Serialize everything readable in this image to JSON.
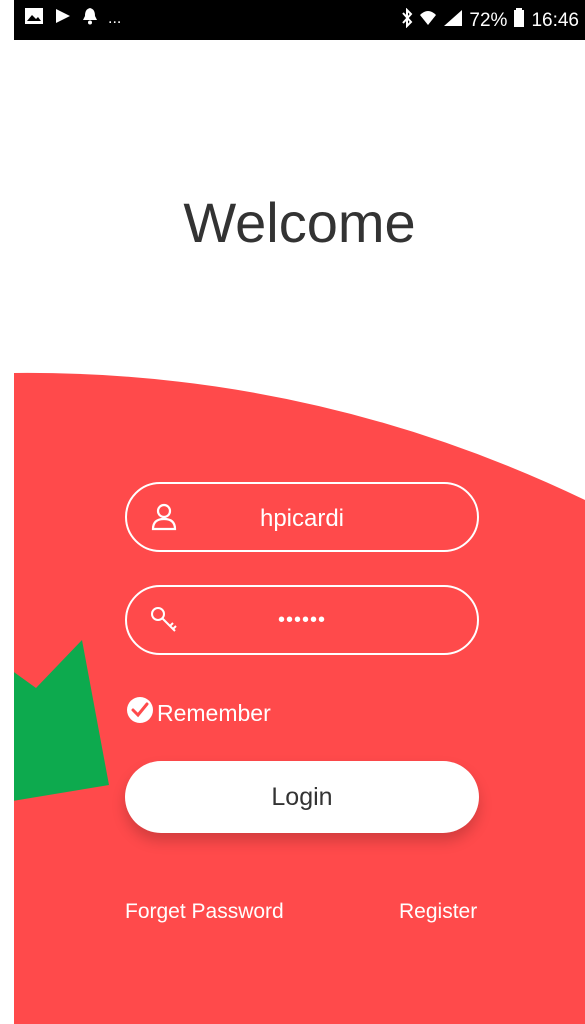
{
  "status_bar": {
    "battery": "72%",
    "time": "16:46",
    "dots": "..."
  },
  "title": "Welcome",
  "username": {
    "value": "hpicardi"
  },
  "password": {
    "masked_value": "••••••"
  },
  "remember": {
    "label": "Remember",
    "checked": true
  },
  "login_button": {
    "label": "Login"
  },
  "forgot_link": {
    "label": "Forget Password"
  },
  "register_link": {
    "label": "Register"
  },
  "colors": {
    "accent": "#FF4A4B",
    "annotation": "#0DAA4E"
  }
}
